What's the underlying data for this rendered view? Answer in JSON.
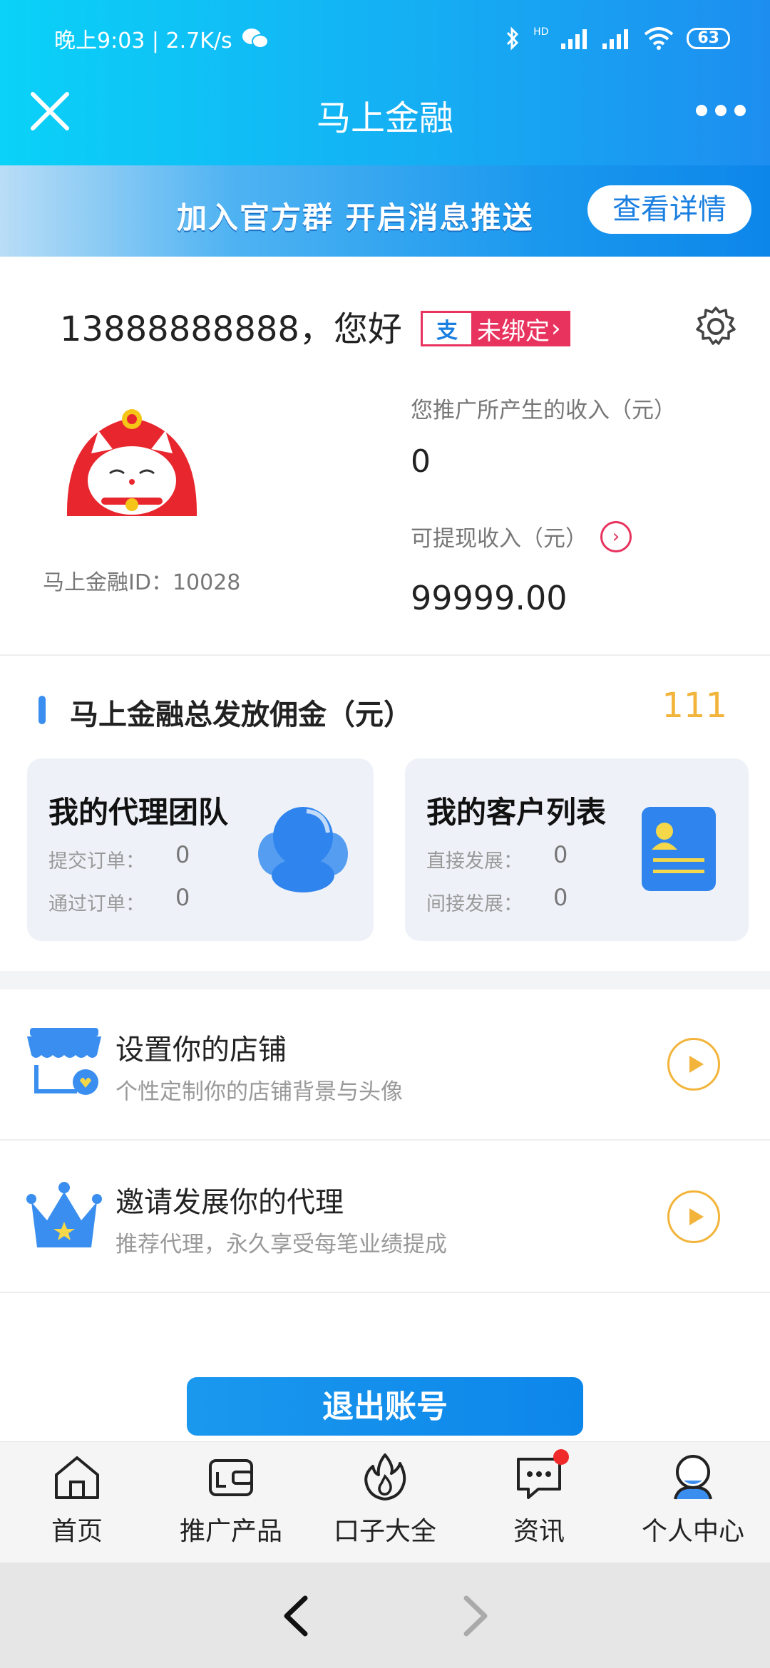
{
  "status_bar": {
    "time_speed": "晚上9:03 | 2.7K/s",
    "signal_tag": "HD",
    "battery": "63"
  },
  "header": {
    "title": "马上金融"
  },
  "banner": {
    "text": "加入官方群  开启消息推送",
    "button": "查看详情"
  },
  "profile": {
    "greeting": "13888888888，您好",
    "bind_status": "未绑定",
    "bind_arrow": "›",
    "user_id": "马上金融ID：10028",
    "income_label": "您推广所产生的收入（元）",
    "income_value": "0",
    "withdraw_label": "可提现收入（元）",
    "withdraw_value": "99999.00"
  },
  "commission": {
    "title": "马上金融总发放佣金（元）",
    "value": "111",
    "cards": [
      {
        "title": "我的代理团队",
        "rows": [
          {
            "label": "提交订单：",
            "value": "0"
          },
          {
            "label": "通过订单：",
            "value": "0"
          }
        ]
      },
      {
        "title": "我的客户列表",
        "rows": [
          {
            "label": "直接发展：",
            "value": "0"
          },
          {
            "label": "间接发展：",
            "value": "0"
          }
        ]
      }
    ]
  },
  "list": [
    {
      "title": "设置你的店铺",
      "subtitle": "个性定制你的店铺背景与头像"
    },
    {
      "title": "邀请发展你的代理",
      "subtitle": "推荐代理，永久享受每笔业绩提成"
    }
  ],
  "logout_label": "退出账号",
  "tabs": [
    {
      "label": "首页"
    },
    {
      "label": "推广产品"
    },
    {
      "label": "口子大全"
    },
    {
      "label": "资讯"
    },
    {
      "label": "个人中心"
    }
  ],
  "colors": {
    "primary": "#1a98ee",
    "accent_gold": "#f2b43a",
    "badge_red": "#e8335e"
  }
}
